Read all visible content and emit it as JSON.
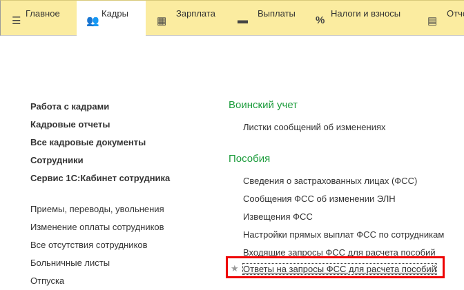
{
  "tabs": [
    {
      "label": "Главное",
      "icon": "menu-icon"
    },
    {
      "label": "Кадры",
      "icon": "users-icon",
      "active": true
    },
    {
      "label": "Зарплата",
      "icon": "calculator-icon"
    },
    {
      "label": "Выплаты",
      "icon": "wallet-icon"
    },
    {
      "label": "Налоги и взносы",
      "icon": "percent-icon"
    },
    {
      "label": "Отчеты",
      "icon": "reports-icon"
    }
  ],
  "left_bold": [
    "Работа с кадрами",
    "Кадровые отчеты",
    "Все кадровые документы",
    "Сотрудники",
    "Сервис 1С:Кабинет сотрудника"
  ],
  "left_links": [
    "Приемы, переводы, увольнения",
    "Изменение оплаты сотрудников",
    "Все отсутствия сотрудников",
    "Больничные листы",
    "Отпуска"
  ],
  "groups": [
    {
      "title": "Воинский учет",
      "items": [
        "Листки сообщений об изменениях"
      ]
    },
    {
      "title": "Пособия",
      "items": [
        "Сведения о застрахованных лицах (ФСС)",
        "Сообщения ФСС об изменении ЭЛН",
        "Извещения ФСС",
        "Настройки прямых выплат ФСС по сотрудникам",
        "Входящие запросы ФСС для расчета пособий",
        "Ответы на запросы ФСС для расчета пособий"
      ]
    }
  ]
}
